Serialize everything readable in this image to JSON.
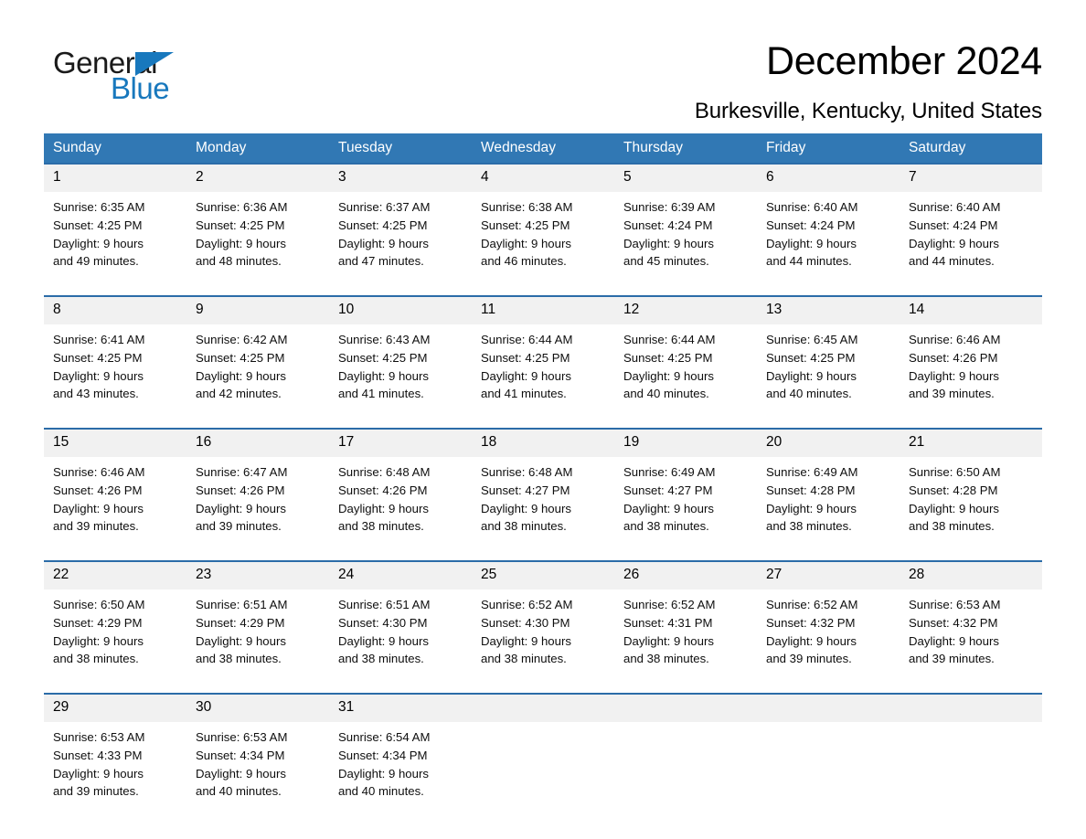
{
  "brand": {
    "name_first": "General",
    "name_second": "Blue",
    "triangle_icon": "triangle-icon",
    "accent_color": "#1878bd"
  },
  "header": {
    "month_title": "December 2024",
    "location": "Burkesville, Kentucky, United States"
  },
  "calendar": {
    "header_bg": "#3178b4",
    "header_text_color": "#ffffff",
    "daynum_bg": "#f1f1f1",
    "week_separator_color": "#2b6ca8",
    "weekday_headers": [
      "Sunday",
      "Monday",
      "Tuesday",
      "Wednesday",
      "Thursday",
      "Friday",
      "Saturday"
    ],
    "weeks": [
      [
        {
          "day": "1",
          "sunrise": "Sunrise: 6:35 AM",
          "sunset": "Sunset: 4:25 PM",
          "daylight_1": "Daylight: 9 hours",
          "daylight_2": "and 49 minutes."
        },
        {
          "day": "2",
          "sunrise": "Sunrise: 6:36 AM",
          "sunset": "Sunset: 4:25 PM",
          "daylight_1": "Daylight: 9 hours",
          "daylight_2": "and 48 minutes."
        },
        {
          "day": "3",
          "sunrise": "Sunrise: 6:37 AM",
          "sunset": "Sunset: 4:25 PM",
          "daylight_1": "Daylight: 9 hours",
          "daylight_2": "and 47 minutes."
        },
        {
          "day": "4",
          "sunrise": "Sunrise: 6:38 AM",
          "sunset": "Sunset: 4:25 PM",
          "daylight_1": "Daylight: 9 hours",
          "daylight_2": "and 46 minutes."
        },
        {
          "day": "5",
          "sunrise": "Sunrise: 6:39 AM",
          "sunset": "Sunset: 4:24 PM",
          "daylight_1": "Daylight: 9 hours",
          "daylight_2": "and 45 minutes."
        },
        {
          "day": "6",
          "sunrise": "Sunrise: 6:40 AM",
          "sunset": "Sunset: 4:24 PM",
          "daylight_1": "Daylight: 9 hours",
          "daylight_2": "and 44 minutes."
        },
        {
          "day": "7",
          "sunrise": "Sunrise: 6:40 AM",
          "sunset": "Sunset: 4:24 PM",
          "daylight_1": "Daylight: 9 hours",
          "daylight_2": "and 44 minutes."
        }
      ],
      [
        {
          "day": "8",
          "sunrise": "Sunrise: 6:41 AM",
          "sunset": "Sunset: 4:25 PM",
          "daylight_1": "Daylight: 9 hours",
          "daylight_2": "and 43 minutes."
        },
        {
          "day": "9",
          "sunrise": "Sunrise: 6:42 AM",
          "sunset": "Sunset: 4:25 PM",
          "daylight_1": "Daylight: 9 hours",
          "daylight_2": "and 42 minutes."
        },
        {
          "day": "10",
          "sunrise": "Sunrise: 6:43 AM",
          "sunset": "Sunset: 4:25 PM",
          "daylight_1": "Daylight: 9 hours",
          "daylight_2": "and 41 minutes."
        },
        {
          "day": "11",
          "sunrise": "Sunrise: 6:44 AM",
          "sunset": "Sunset: 4:25 PM",
          "daylight_1": "Daylight: 9 hours",
          "daylight_2": "and 41 minutes."
        },
        {
          "day": "12",
          "sunrise": "Sunrise: 6:44 AM",
          "sunset": "Sunset: 4:25 PM",
          "daylight_1": "Daylight: 9 hours",
          "daylight_2": "and 40 minutes."
        },
        {
          "day": "13",
          "sunrise": "Sunrise: 6:45 AM",
          "sunset": "Sunset: 4:25 PM",
          "daylight_1": "Daylight: 9 hours",
          "daylight_2": "and 40 minutes."
        },
        {
          "day": "14",
          "sunrise": "Sunrise: 6:46 AM",
          "sunset": "Sunset: 4:26 PM",
          "daylight_1": "Daylight: 9 hours",
          "daylight_2": "and 39 minutes."
        }
      ],
      [
        {
          "day": "15",
          "sunrise": "Sunrise: 6:46 AM",
          "sunset": "Sunset: 4:26 PM",
          "daylight_1": "Daylight: 9 hours",
          "daylight_2": "and 39 minutes."
        },
        {
          "day": "16",
          "sunrise": "Sunrise: 6:47 AM",
          "sunset": "Sunset: 4:26 PM",
          "daylight_1": "Daylight: 9 hours",
          "daylight_2": "and 39 minutes."
        },
        {
          "day": "17",
          "sunrise": "Sunrise: 6:48 AM",
          "sunset": "Sunset: 4:26 PM",
          "daylight_1": "Daylight: 9 hours",
          "daylight_2": "and 38 minutes."
        },
        {
          "day": "18",
          "sunrise": "Sunrise: 6:48 AM",
          "sunset": "Sunset: 4:27 PM",
          "daylight_1": "Daylight: 9 hours",
          "daylight_2": "and 38 minutes."
        },
        {
          "day": "19",
          "sunrise": "Sunrise: 6:49 AM",
          "sunset": "Sunset: 4:27 PM",
          "daylight_1": "Daylight: 9 hours",
          "daylight_2": "and 38 minutes."
        },
        {
          "day": "20",
          "sunrise": "Sunrise: 6:49 AM",
          "sunset": "Sunset: 4:28 PM",
          "daylight_1": "Daylight: 9 hours",
          "daylight_2": "and 38 minutes."
        },
        {
          "day": "21",
          "sunrise": "Sunrise: 6:50 AM",
          "sunset": "Sunset: 4:28 PM",
          "daylight_1": "Daylight: 9 hours",
          "daylight_2": "and 38 minutes."
        }
      ],
      [
        {
          "day": "22",
          "sunrise": "Sunrise: 6:50 AM",
          "sunset": "Sunset: 4:29 PM",
          "daylight_1": "Daylight: 9 hours",
          "daylight_2": "and 38 minutes."
        },
        {
          "day": "23",
          "sunrise": "Sunrise: 6:51 AM",
          "sunset": "Sunset: 4:29 PM",
          "daylight_1": "Daylight: 9 hours",
          "daylight_2": "and 38 minutes."
        },
        {
          "day": "24",
          "sunrise": "Sunrise: 6:51 AM",
          "sunset": "Sunset: 4:30 PM",
          "daylight_1": "Daylight: 9 hours",
          "daylight_2": "and 38 minutes."
        },
        {
          "day": "25",
          "sunrise": "Sunrise: 6:52 AM",
          "sunset": "Sunset: 4:30 PM",
          "daylight_1": "Daylight: 9 hours",
          "daylight_2": "and 38 minutes."
        },
        {
          "day": "26",
          "sunrise": "Sunrise: 6:52 AM",
          "sunset": "Sunset: 4:31 PM",
          "daylight_1": "Daylight: 9 hours",
          "daylight_2": "and 38 minutes."
        },
        {
          "day": "27",
          "sunrise": "Sunrise: 6:52 AM",
          "sunset": "Sunset: 4:32 PM",
          "daylight_1": "Daylight: 9 hours",
          "daylight_2": "and 39 minutes."
        },
        {
          "day": "28",
          "sunrise": "Sunrise: 6:53 AM",
          "sunset": "Sunset: 4:32 PM",
          "daylight_1": "Daylight: 9 hours",
          "daylight_2": "and 39 minutes."
        }
      ],
      [
        {
          "day": "29",
          "sunrise": "Sunrise: 6:53 AM",
          "sunset": "Sunset: 4:33 PM",
          "daylight_1": "Daylight: 9 hours",
          "daylight_2": "and 39 minutes."
        },
        {
          "day": "30",
          "sunrise": "Sunrise: 6:53 AM",
          "sunset": "Sunset: 4:34 PM",
          "daylight_1": "Daylight: 9 hours",
          "daylight_2": "and 40 minutes."
        },
        {
          "day": "31",
          "sunrise": "Sunrise: 6:54 AM",
          "sunset": "Sunset: 4:34 PM",
          "daylight_1": "Daylight: 9 hours",
          "daylight_2": "and 40 minutes."
        },
        {
          "day": "",
          "sunrise": "",
          "sunset": "",
          "daylight_1": "",
          "daylight_2": ""
        },
        {
          "day": "",
          "sunrise": "",
          "sunset": "",
          "daylight_1": "",
          "daylight_2": ""
        },
        {
          "day": "",
          "sunrise": "",
          "sunset": "",
          "daylight_1": "",
          "daylight_2": ""
        },
        {
          "day": "",
          "sunrise": "",
          "sunset": "",
          "daylight_1": "",
          "daylight_2": ""
        }
      ]
    ]
  }
}
